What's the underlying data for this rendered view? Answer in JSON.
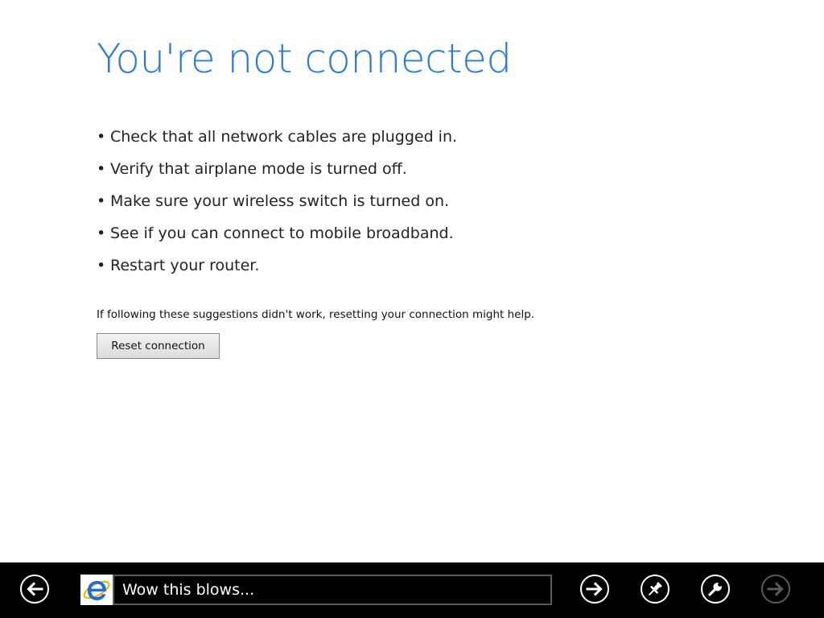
{
  "main": {
    "title": "You're not connected",
    "bullet_glyph": "•",
    "suggestions": [
      "Check that all network cables are plugged in.",
      "Verify that airplane mode is turned off.",
      "Make sure your wireless switch is turned on.",
      "See if you can connect to mobile broadband.",
      "Restart your router."
    ],
    "hint": "If following these suggestions didn't work, resetting your connection might help.",
    "reset_button_label": "Reset connection"
  },
  "appbar": {
    "address_value": "Wow this blows...",
    "buttons": {
      "back": {
        "icon": "back-arrow-icon",
        "enabled": true
      },
      "go": {
        "icon": "go-arrow-icon",
        "enabled": true
      },
      "pin": {
        "icon": "pin-icon",
        "enabled": true
      },
      "tools": {
        "icon": "wrench-icon",
        "enabled": true
      },
      "forward": {
        "icon": "forward-arrow-icon",
        "enabled": false
      }
    },
    "site_icon": "internet-explorer-logo-icon"
  },
  "colors": {
    "title": "#2b7bd9",
    "appbar_background": "#000000",
    "ie_logo_blue": "#1e6fd0",
    "disabled_icon": "#5a5a5a"
  }
}
